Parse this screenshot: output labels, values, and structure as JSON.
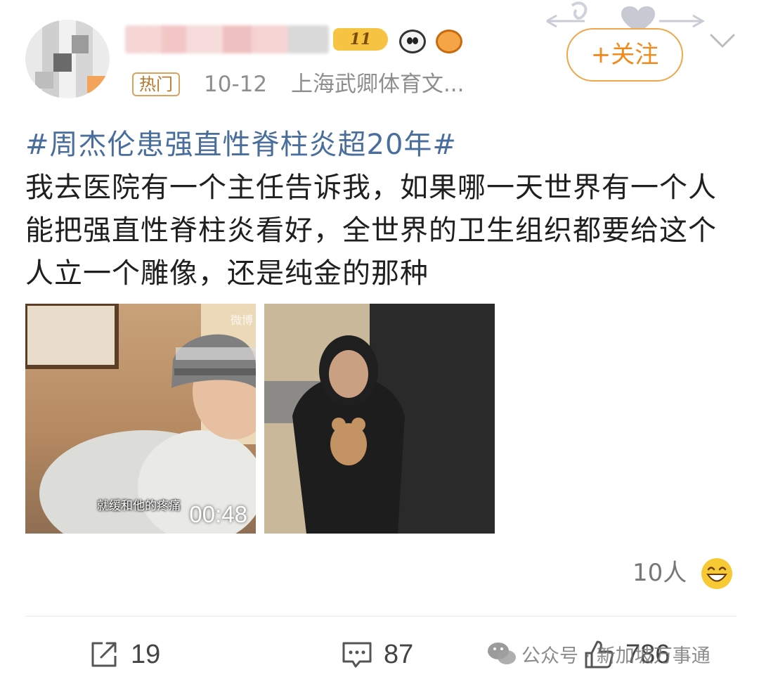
{
  "header": {
    "level_badge": "11",
    "follow_label": "+关注",
    "hot_badge": "热门",
    "date": "10-12",
    "source": "上海武卿体育文..."
  },
  "post": {
    "hashtag": "#周杰伦患强直性脊柱炎超20年#",
    "text": "我去医院有一个主任告诉我，如果哪一天世界有一个人能把强直性脊柱炎看好，全世界的卫生组织都要给这个人立一个雕像，还是纯金的那种"
  },
  "media": {
    "video_subtitle": "就缓和他的疼痛",
    "video_duration": "00:48",
    "video_watermark": "微博"
  },
  "reactions": {
    "count_label": "10人",
    "emoji": "grin-emoji"
  },
  "actions": {
    "repost_count": "19",
    "comment_count": "87",
    "like_count": "786"
  },
  "watermark": {
    "text": "公众号 · 新加坡万事通"
  },
  "colors": {
    "follow_accent": "#f08a1c",
    "hashtag": "#496d9c",
    "meta_gray": "#8e8e8e"
  }
}
